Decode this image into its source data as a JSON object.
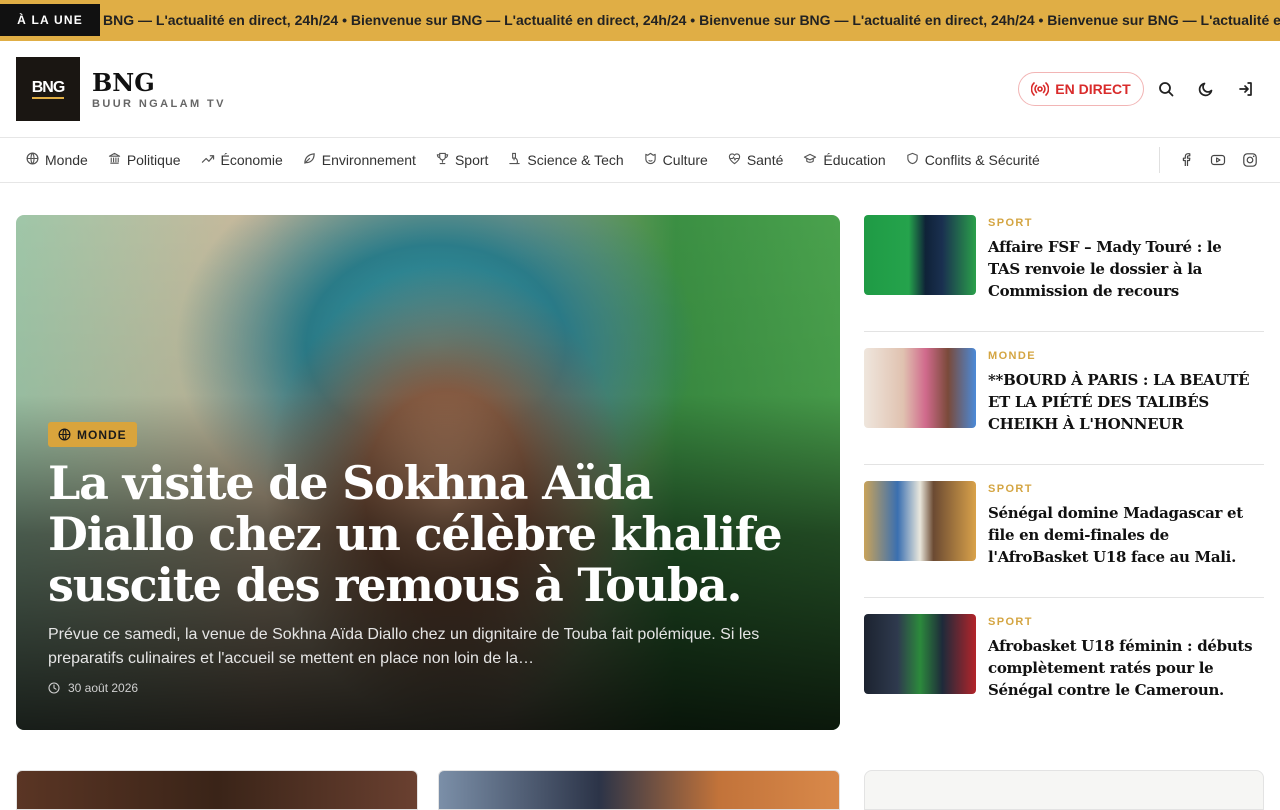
{
  "ticker": {
    "badge": "À LA UNE",
    "text": "BNG — L'actualité en direct, 24h/24 • Bienvenue sur BNG — L'actualité en direct, 24h/24 • Bienvenue sur BNG — L'actualité en direct, 24h/24 • Bienvenue sur BNG — L'actualité en direct, 24h/24"
  },
  "header": {
    "logo_text": "BNG",
    "brand_name": "BNG",
    "brand_sub": "BUUR NGALAM TV",
    "live_label": "EN DIRECT"
  },
  "nav": {
    "items": [
      "Monde",
      "Politique",
      "Économie",
      "Environnement",
      "Sport",
      "Science & Tech",
      "Culture",
      "Santé",
      "Éducation",
      "Conflits & Sécurité"
    ]
  },
  "hero": {
    "category": "MONDE",
    "title": "La visite de Sokhna Aïda Diallo chez un célèbre khalife suscite des remous à Touba.",
    "description": "Prévue ce samedi, la venue de Sokhna Aïda Diallo chez un dignitaire de Touba fait polémique. Si les preparatifs culinaires et l'accueil se mettent en place non loin de la…",
    "date": "30 août 2026"
  },
  "side_articles": [
    {
      "category": "SPORT",
      "title": "Affaire FSF – Mady Touré : le TAS renvoie le dossier à la Commission de recours"
    },
    {
      "category": "MONDE",
      "title": "**BOURD À PARIS : LA BEAUTÉ ET LA PIÉTÉ DES TALIBÉS CHEIKH À L'HONNEUR"
    },
    {
      "category": "SPORT",
      "title": "Sénégal domine Madagascar et file en demi-finales de l'AfroBasket U18 face au Mali."
    },
    {
      "category": "SPORT",
      "title": "Afrobasket U18 féminin : débuts complètement ratés pour le Sénégal contre le Cameroun."
    }
  ],
  "colors": {
    "accent": "#e0ae45",
    "live": "#d92b2b",
    "category": "#d4a542"
  }
}
